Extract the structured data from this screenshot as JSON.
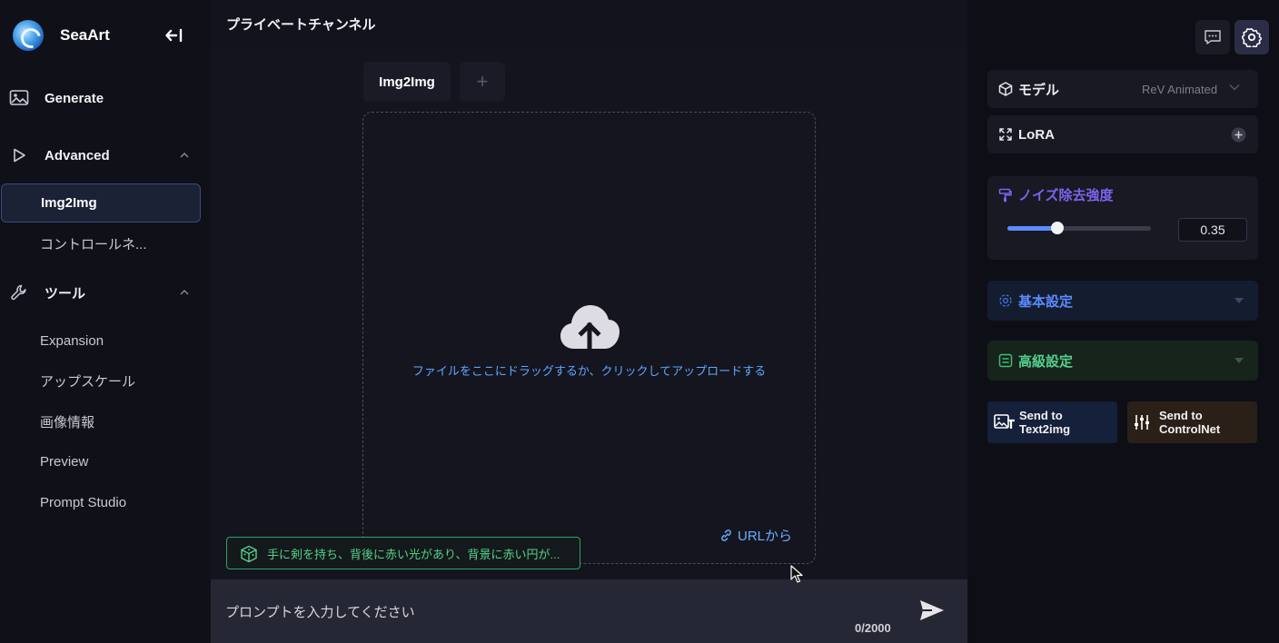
{
  "app": {
    "name": "SeaArt"
  },
  "sidebar": {
    "items": [
      {
        "label": "Generate"
      },
      {
        "label": "Advanced"
      },
      {
        "label": "ツール"
      }
    ],
    "advanced_children": [
      {
        "label": "Img2Img",
        "active": true
      },
      {
        "label": "コントロールネ..."
      }
    ],
    "tool_children": [
      {
        "label": "Expansion"
      },
      {
        "label": "アップスケール"
      },
      {
        "label": "画像情報"
      },
      {
        "label": "Preview"
      },
      {
        "label": "Prompt Studio"
      }
    ]
  },
  "main": {
    "channel_title": "プライベートチャンネル",
    "tabs": [
      {
        "label": "Img2Img"
      },
      {
        "label": "+"
      }
    ],
    "upload": {
      "hint": "ファイルをここにドラッグするか、クリックしてアップロードする",
      "url_link": "URLから"
    },
    "suggested_prompt": "手に剣を持ち、背後に赤い光があり、背景に赤い円が...",
    "prompt": {
      "placeholder": "プロンプトを入力してください",
      "char_count": "0/2000"
    }
  },
  "right_panel": {
    "model": {
      "label": "モデル",
      "value": "ReV Animated"
    },
    "lora": {
      "label": "LoRA"
    },
    "noise": {
      "label": "ノイズ除去強度",
      "value": "0.35",
      "fraction": 0.35
    },
    "basic_settings": {
      "label": "基本設定"
    },
    "advanced_settings": {
      "label": "高級設定"
    },
    "send_text2img": {
      "label": "Send to Text2img"
    },
    "send_controlnet": {
      "label": "Send to ControlNet"
    }
  },
  "colors": {
    "accent_blue": "#5b8cff",
    "noise_purple": "#7d63f0",
    "suggest_green": "#54d08c",
    "basic_bg": "#141c30",
    "advanced_bg": "#16241c"
  }
}
